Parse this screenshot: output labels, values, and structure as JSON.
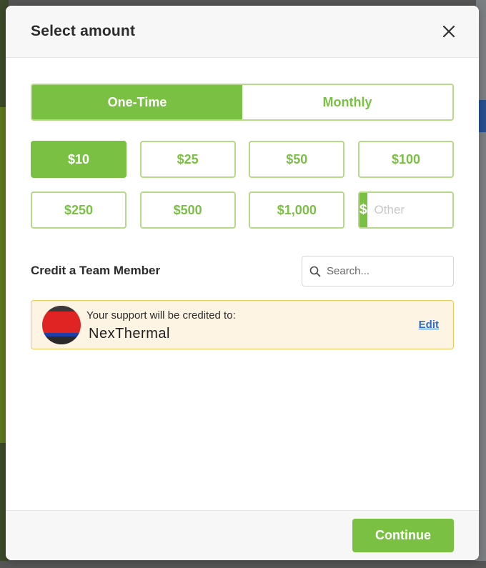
{
  "modal": {
    "title": "Select amount"
  },
  "frequency": {
    "options": [
      {
        "label": "One-Time",
        "active": true
      },
      {
        "label": "Monthly",
        "active": false
      }
    ]
  },
  "amounts": {
    "row1": [
      "$10",
      "$25",
      "$50",
      "$100"
    ],
    "row2": [
      "$250",
      "$500",
      "$1,000"
    ],
    "selected": "$10",
    "other": {
      "prefix": "$",
      "placeholder": "Other"
    }
  },
  "credit": {
    "label": "Credit a Team Member",
    "search_placeholder": "Search...",
    "caption": "Your support will be credited to:",
    "name": "NexThermal",
    "edit_label": "Edit"
  },
  "footer": {
    "continue_label": "Continue"
  },
  "colors": {
    "accent": "#7ac143",
    "accent_border": "#b7d98a",
    "notice_bg": "#fdf4e3",
    "notice_border": "#f0c75e",
    "link": "#2a6bd6"
  }
}
